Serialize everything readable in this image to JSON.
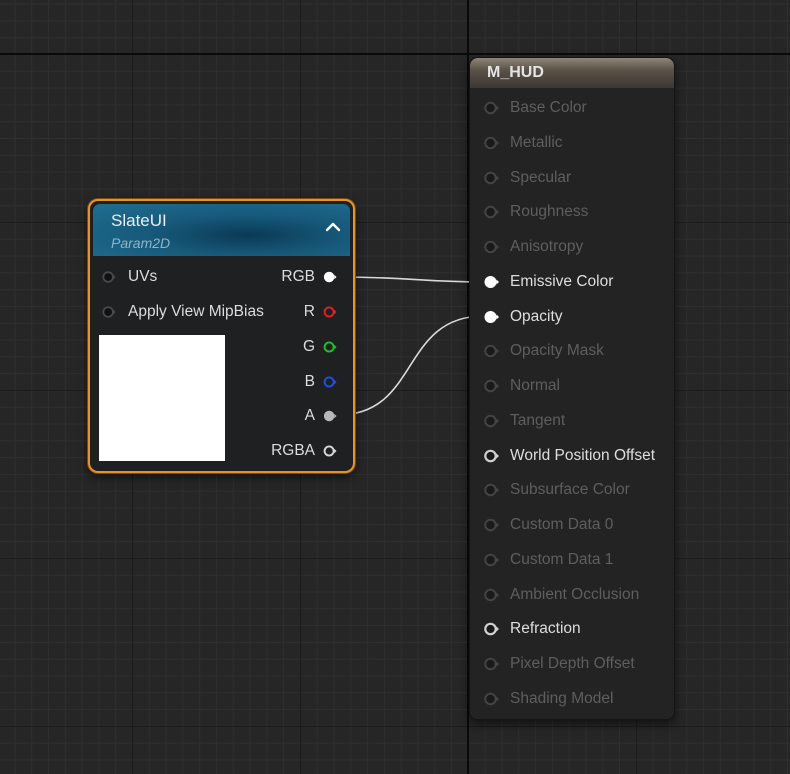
{
  "colors": {
    "selected_border": "#e5932a",
    "pin_red": "#e02020",
    "pin_green": "#1ec21e",
    "pin_blue": "#2050e0",
    "wire": "#d9d9d9",
    "inactive_text": "#5e5e5e",
    "active_text": "#dedede"
  },
  "slate_node": {
    "title": "SlateUI",
    "subtitle": "Param2D",
    "collapse_icon": "chevron-up-icon",
    "inputs": [
      {
        "label": "UVs",
        "connected": false
      },
      {
        "label": "Apply View MipBias",
        "connected": false
      }
    ],
    "outputs": [
      {
        "label": "RGB",
        "pin": "white-filled"
      },
      {
        "label": "R",
        "pin": "red"
      },
      {
        "label": "G",
        "pin": "green"
      },
      {
        "label": "B",
        "pin": "blue"
      },
      {
        "label": "A",
        "pin": "grey-filled"
      },
      {
        "label": "RGBA",
        "pin": "white-outline"
      }
    ]
  },
  "material_node": {
    "title": "M_HUD",
    "pins": [
      {
        "label": "Base Color",
        "state": "disabled"
      },
      {
        "label": "Metallic",
        "state": "disabled"
      },
      {
        "label": "Specular",
        "state": "disabled"
      },
      {
        "label": "Roughness",
        "state": "disabled"
      },
      {
        "label": "Anisotropy",
        "state": "disabled"
      },
      {
        "label": "Emissive Color",
        "state": "connected"
      },
      {
        "label": "Opacity",
        "state": "connected"
      },
      {
        "label": "Opacity Mask",
        "state": "disabled"
      },
      {
        "label": "Normal",
        "state": "disabled"
      },
      {
        "label": "Tangent",
        "state": "disabled"
      },
      {
        "label": "World Position Offset",
        "state": "enabled"
      },
      {
        "label": "Subsurface Color",
        "state": "disabled"
      },
      {
        "label": "Custom Data 0",
        "state": "disabled"
      },
      {
        "label": "Custom Data 1",
        "state": "disabled"
      },
      {
        "label": "Ambient Occlusion",
        "state": "disabled"
      },
      {
        "label": "Refraction",
        "state": "enabled"
      },
      {
        "label": "Pixel Depth Offset",
        "state": "disabled"
      },
      {
        "label": "Shading Model",
        "state": "disabled"
      }
    ]
  },
  "connections": [
    {
      "from": "SlateUI.RGB",
      "to": "M_HUD.Emissive Color"
    },
    {
      "from": "SlateUI.A",
      "to": "M_HUD.Opacity"
    }
  ]
}
